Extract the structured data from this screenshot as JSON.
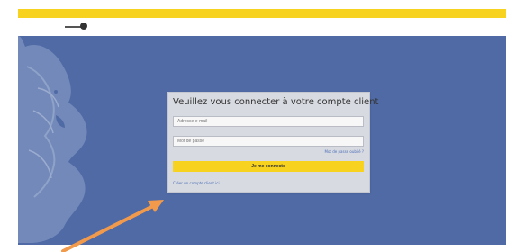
{
  "header": {
    "title": ""
  },
  "login": {
    "title": "Veuillez vous connecter à votre compte client",
    "email_placeholder": "Adresse e-mail",
    "password_placeholder": "Mot de passe",
    "forgot_link": "Mot de passe oublié ?",
    "submit_label": "Je me connecte",
    "create_account_link": "Créer un compte client ici"
  },
  "colors": {
    "accent": "#f7d21e",
    "hero_background": "#4f6aa5",
    "annotation_arrow": "#f29a4b"
  },
  "icons": {
    "brand": "toggle-icon",
    "decoration": "lion-icon",
    "annotation": "arrow-icon"
  }
}
